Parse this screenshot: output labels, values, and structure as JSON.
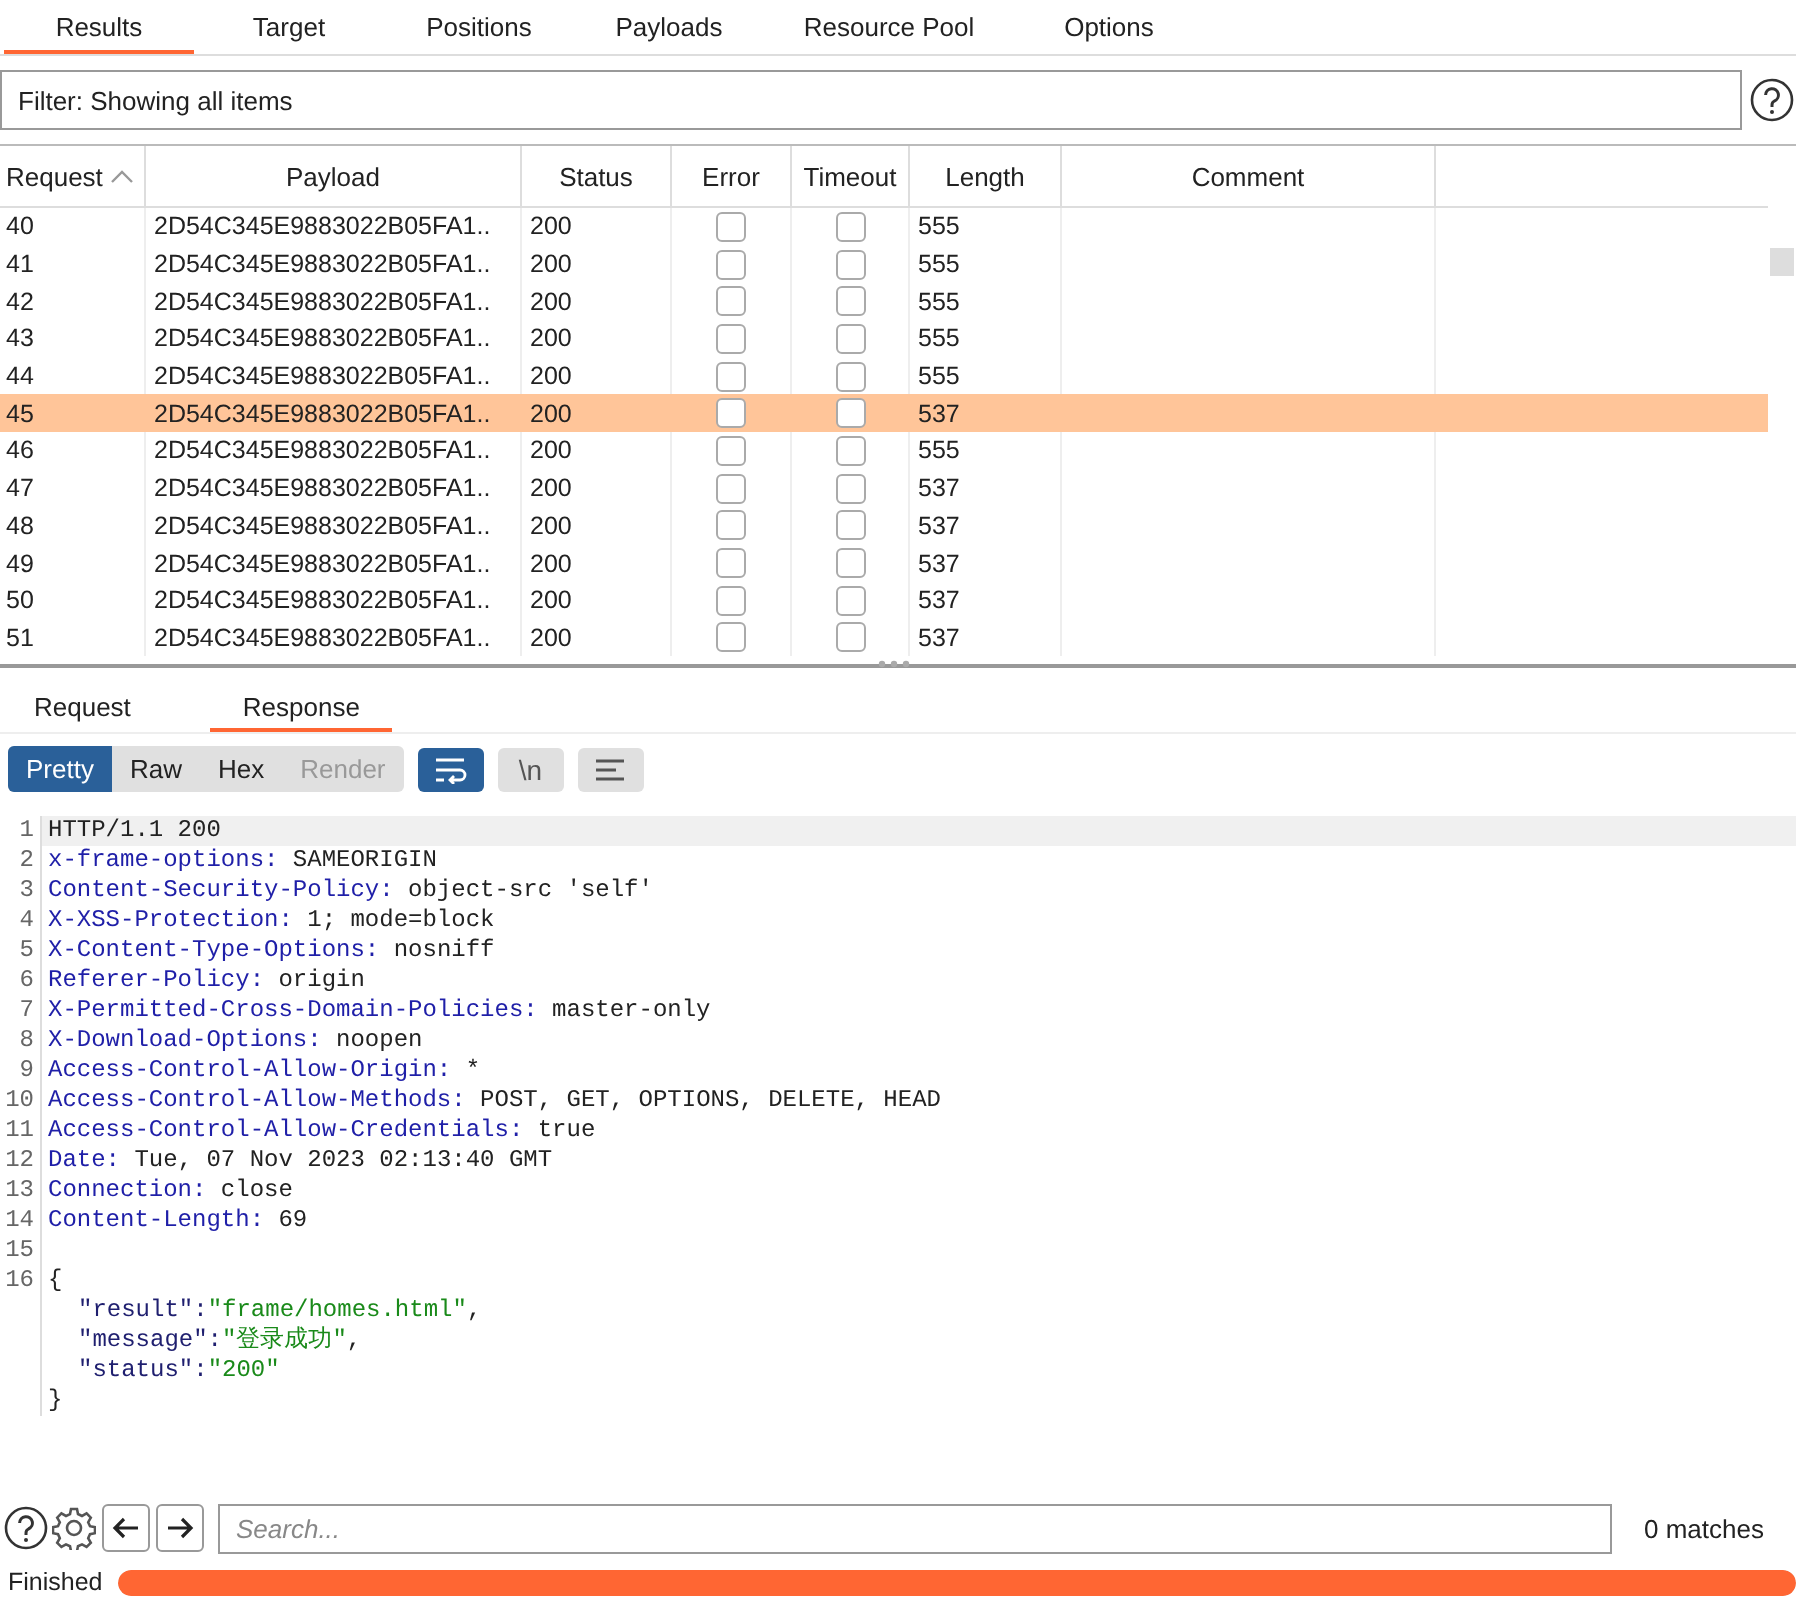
{
  "tabs": [
    {
      "label": "Results",
      "selected": true
    },
    {
      "label": "Target",
      "selected": false
    },
    {
      "label": "Positions",
      "selected": false
    },
    {
      "label": "Payloads",
      "selected": false
    },
    {
      "label": "Resource Pool",
      "selected": false
    },
    {
      "label": "Options",
      "selected": false
    }
  ],
  "filter": {
    "text": "Filter: Showing all items"
  },
  "table": {
    "columns": [
      {
        "label": "Request",
        "sorted": true
      },
      {
        "label": "Payload",
        "sorted": false
      },
      {
        "label": "Status",
        "sorted": false
      },
      {
        "label": "Error",
        "sorted": false
      },
      {
        "label": "Timeout",
        "sorted": false
      },
      {
        "label": "Length",
        "sorted": false
      },
      {
        "label": "Comment",
        "sorted": false
      }
    ],
    "rows": [
      {
        "request": "40",
        "payload": "2D54C345E9883022B05FA1..",
        "status": "200",
        "error": false,
        "timeout": false,
        "length": "555",
        "selected": false
      },
      {
        "request": "41",
        "payload": "2D54C345E9883022B05FA1..",
        "status": "200",
        "error": false,
        "timeout": false,
        "length": "555",
        "selected": false
      },
      {
        "request": "42",
        "payload": "2D54C345E9883022B05FA1..",
        "status": "200",
        "error": false,
        "timeout": false,
        "length": "555",
        "selected": false
      },
      {
        "request": "43",
        "payload": "2D54C345E9883022B05FA1..",
        "status": "200",
        "error": false,
        "timeout": false,
        "length": "555",
        "selected": false
      },
      {
        "request": "44",
        "payload": "2D54C345E9883022B05FA1..",
        "status": "200",
        "error": false,
        "timeout": false,
        "length": "555",
        "selected": false
      },
      {
        "request": "45",
        "payload": "2D54C345E9883022B05FA1..",
        "status": "200",
        "error": false,
        "timeout": false,
        "length": "537",
        "selected": true
      },
      {
        "request": "46",
        "payload": "2D54C345E9883022B05FA1..",
        "status": "200",
        "error": false,
        "timeout": false,
        "length": "555",
        "selected": false
      },
      {
        "request": "47",
        "payload": "2D54C345E9883022B05FA1..",
        "status": "200",
        "error": false,
        "timeout": false,
        "length": "537",
        "selected": false
      },
      {
        "request": "48",
        "payload": "2D54C345E9883022B05FA1..",
        "status": "200",
        "error": false,
        "timeout": false,
        "length": "537",
        "selected": false
      },
      {
        "request": "49",
        "payload": "2D54C345E9883022B05FA1..",
        "status": "200",
        "error": false,
        "timeout": false,
        "length": "537",
        "selected": false
      },
      {
        "request": "50",
        "payload": "2D54C345E9883022B05FA1..",
        "status": "200",
        "error": false,
        "timeout": false,
        "length": "537",
        "selected": false
      },
      {
        "request": "51",
        "payload": "2D54C345E9883022B05FA1..",
        "status": "200",
        "error": false,
        "timeout": false,
        "length": "537",
        "selected": false
      }
    ]
  },
  "detail_tabs": [
    {
      "label": "Request",
      "selected": false
    },
    {
      "label": "Response",
      "selected": true
    }
  ],
  "view_modes": [
    {
      "label": "Pretty",
      "selected": true,
      "disabled": false
    },
    {
      "label": "Raw",
      "selected": false,
      "disabled": false
    },
    {
      "label": "Hex",
      "selected": false,
      "disabled": false
    },
    {
      "label": "Render",
      "selected": false,
      "disabled": true
    }
  ],
  "toggles": [
    {
      "kind": "wrap",
      "on": true
    },
    {
      "kind": "newline",
      "label": "\\n",
      "on": false
    },
    {
      "kind": "menu",
      "on": false
    }
  ],
  "code_lines": [
    {
      "number": "1",
      "kind": "text",
      "text": "HTTP/1.1 200"
    },
    {
      "number": "2",
      "kind": "header",
      "name": "x-frame-options:",
      "value": "SAMEORIGIN"
    },
    {
      "number": "3",
      "kind": "header",
      "name": "Content-Security-Policy:",
      "value": "object-src 'self'"
    },
    {
      "number": "4",
      "kind": "header",
      "name": "X-XSS-Protection:",
      "value": "1; mode=block"
    },
    {
      "number": "5",
      "kind": "header",
      "name": "X-Content-Type-Options:",
      "value": "nosniff"
    },
    {
      "number": "6",
      "kind": "header",
      "name": "Referer-Policy:",
      "value": "origin"
    },
    {
      "number": "7",
      "kind": "header",
      "name": "X-Permitted-Cross-Domain-Policies:",
      "value": "master-only"
    },
    {
      "number": "8",
      "kind": "header",
      "name": "X-Download-Options:",
      "value": "noopen"
    },
    {
      "number": "9",
      "kind": "header",
      "name": "Access-Control-Allow-Origin:",
      "value": "*"
    },
    {
      "number": "10",
      "kind": "header",
      "name": "Access-Control-Allow-Methods:",
      "value": "POST, GET, OPTIONS, DELETE, HEAD"
    },
    {
      "number": "11",
      "kind": "header",
      "name": "Access-Control-Allow-Credentials:",
      "value": "true"
    },
    {
      "number": "12",
      "kind": "header",
      "name": "Date:",
      "value": "Tue, 07 Nov 2023 02:13:40 GMT"
    },
    {
      "number": "13",
      "kind": "header",
      "name": "Connection:",
      "value": "close"
    },
    {
      "number": "14",
      "kind": "header",
      "name": "Content-Length:",
      "value": "69"
    },
    {
      "number": "15",
      "kind": "blank"
    },
    {
      "number": "16",
      "kind": "text",
      "text": "{"
    },
    {
      "kind": "json",
      "key": "\"result\":",
      "value": "\"frame/homes.html\"",
      "tail": ","
    },
    {
      "kind": "json",
      "key": "\"message\":",
      "value": "\"登录成功\"",
      "tail": ","
    },
    {
      "kind": "json",
      "key": "\"status\":",
      "value": "\"200\""
    },
    {
      "kind": "text",
      "text": "}"
    }
  ],
  "search": {
    "placeholder": "Search...",
    "matches": "0 matches"
  },
  "status_bar": {
    "text": "Finished",
    "level": 1
  }
}
